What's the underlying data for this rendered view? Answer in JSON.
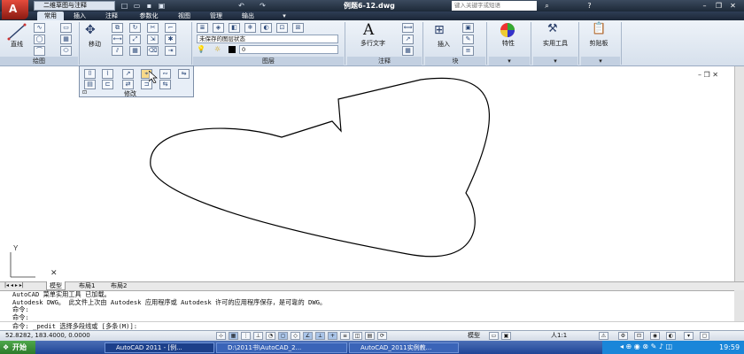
{
  "titlebar": {
    "workspace": "二维草图与注释",
    "doc_title": "例题6-12.dwg",
    "search_placeholder": "键入关键字或短语",
    "qa_icons": [
      "new-icon",
      "open-icon",
      "save-icon",
      "undo-icon",
      "redo-icon",
      "plot-icon"
    ]
  },
  "tabs": [
    "常用",
    "插入",
    "注释",
    "参数化",
    "视图",
    "管理",
    "输出"
  ],
  "ribbon": {
    "draw": {
      "line_label": "直线",
      "title": "绘图"
    },
    "modify": {
      "move_label": "移动",
      "title": "修改"
    },
    "layers": {
      "state": "未保存的图层状态",
      "current_layer": "0",
      "title": "图层"
    },
    "annotation": {
      "mtext_label": "多行文字",
      "title": "注释"
    },
    "block": {
      "insert_label": "插入",
      "title": "块"
    },
    "properties_label": "特性",
    "utilities_label": "实用工具",
    "clipboard_label": "剪贴板"
  },
  "layout_tabs": [
    "模型",
    "布局1",
    "布局2"
  ],
  "command": {
    "history": [
      "AutoCAD 菜单实用工具 已加载。",
      "Autodesk DWG。  此文件上次由 Autodesk 应用程序或 Autodesk 许可的应用程序保存，是可靠的 DWG。",
      "命令:",
      "命令:",
      "命令: _pedit 选择多段线或 [多条(M)]:"
    ]
  },
  "status": {
    "coords": "52.8282,  183.4000,  0.0000",
    "model_label": "模型",
    "scale": "人1:1"
  },
  "taskbar": {
    "start": "开始",
    "tasks": [
      "AutoCAD 2011 - [例...",
      "D:\\2011书\\AutoCAD_2...",
      "AutoCAD_2011实例教..."
    ],
    "clock": "19:59"
  }
}
